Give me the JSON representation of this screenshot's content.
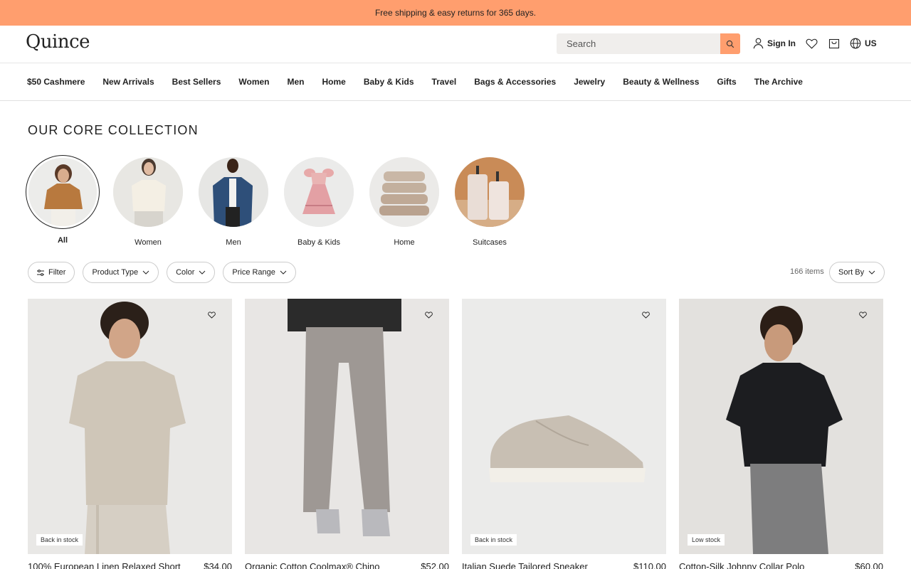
{
  "promo": {
    "text": "Free shipping & easy returns for 365 days."
  },
  "header": {
    "logo": "Quince",
    "search_placeholder": "Search",
    "sign_in": "Sign In",
    "region": "US"
  },
  "nav": {
    "items": [
      "$50 Cashmere",
      "New Arrivals",
      "Best Sellers",
      "Women",
      "Men",
      "Home",
      "Baby & Kids",
      "Travel",
      "Bags & Accessories",
      "Jewelry",
      "Beauty & Wellness",
      "Gifts",
      "The Archive"
    ]
  },
  "collection": {
    "title": "OUR CORE COLLECTION",
    "categories": [
      {
        "label": "All",
        "selected": true
      },
      {
        "label": "Women"
      },
      {
        "label": "Men"
      },
      {
        "label": "Baby & Kids"
      },
      {
        "label": "Home"
      },
      {
        "label": "Suitcases"
      }
    ]
  },
  "filters": {
    "filter": "Filter",
    "product_type": "Product Type",
    "color": "Color",
    "price_range": "Price Range",
    "items_count": "166 items",
    "sort_by": "Sort By"
  },
  "products": [
    {
      "name": "100% European Linen Relaxed Short",
      "price": "$34.00",
      "badge": "Back in stock"
    },
    {
      "name": "Organic Cotton Coolmax® Chino",
      "price": "$52.00",
      "badge": ""
    },
    {
      "name": "Italian Suede Tailored Sneaker",
      "price": "$110.00",
      "badge": "Back in stock"
    },
    {
      "name": "Cotton-Silk Johnny Collar Polo",
      "price": "$60.00",
      "badge": "Low stock"
    }
  ],
  "colors": {
    "accent": "#ff9e6e",
    "background": "#ffffff",
    "text": "#1a1a1a"
  }
}
